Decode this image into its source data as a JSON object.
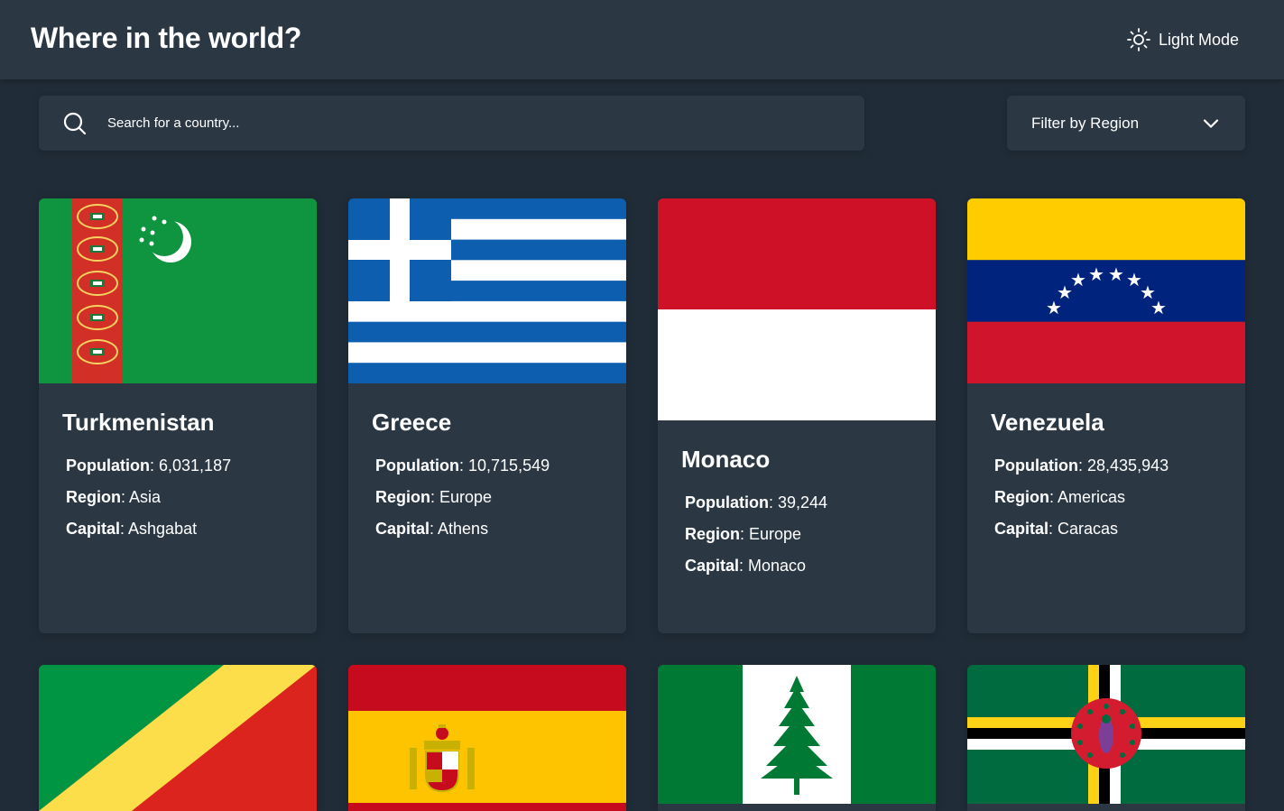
{
  "header": {
    "title": "Where in the world?",
    "mode_label": "Light Mode",
    "mode_icon": "sun-icon"
  },
  "search": {
    "placeholder": "Search for a country...",
    "icon": "search-icon"
  },
  "filter": {
    "label": "Filter by Region",
    "icon": "chevron-down-icon"
  },
  "labels": {
    "population": "Population",
    "region": "Region",
    "capital": "Capital"
  },
  "countries": [
    {
      "name": "Turkmenistan",
      "population": "6,031,187",
      "region": "Asia",
      "capital": "Ashgabat"
    },
    {
      "name": "Greece",
      "population": "10,715,549",
      "region": "Europe",
      "capital": "Athens"
    },
    {
      "name": "Monaco",
      "population": "39,244",
      "region": "Europe",
      "capital": "Monaco"
    },
    {
      "name": "Venezuela",
      "population": "28,435,943",
      "region": "Americas",
      "capital": "Caracas"
    }
  ],
  "colors": {
    "background": "#202c37",
    "elements": "#2b3844",
    "text": "#ffffff"
  }
}
